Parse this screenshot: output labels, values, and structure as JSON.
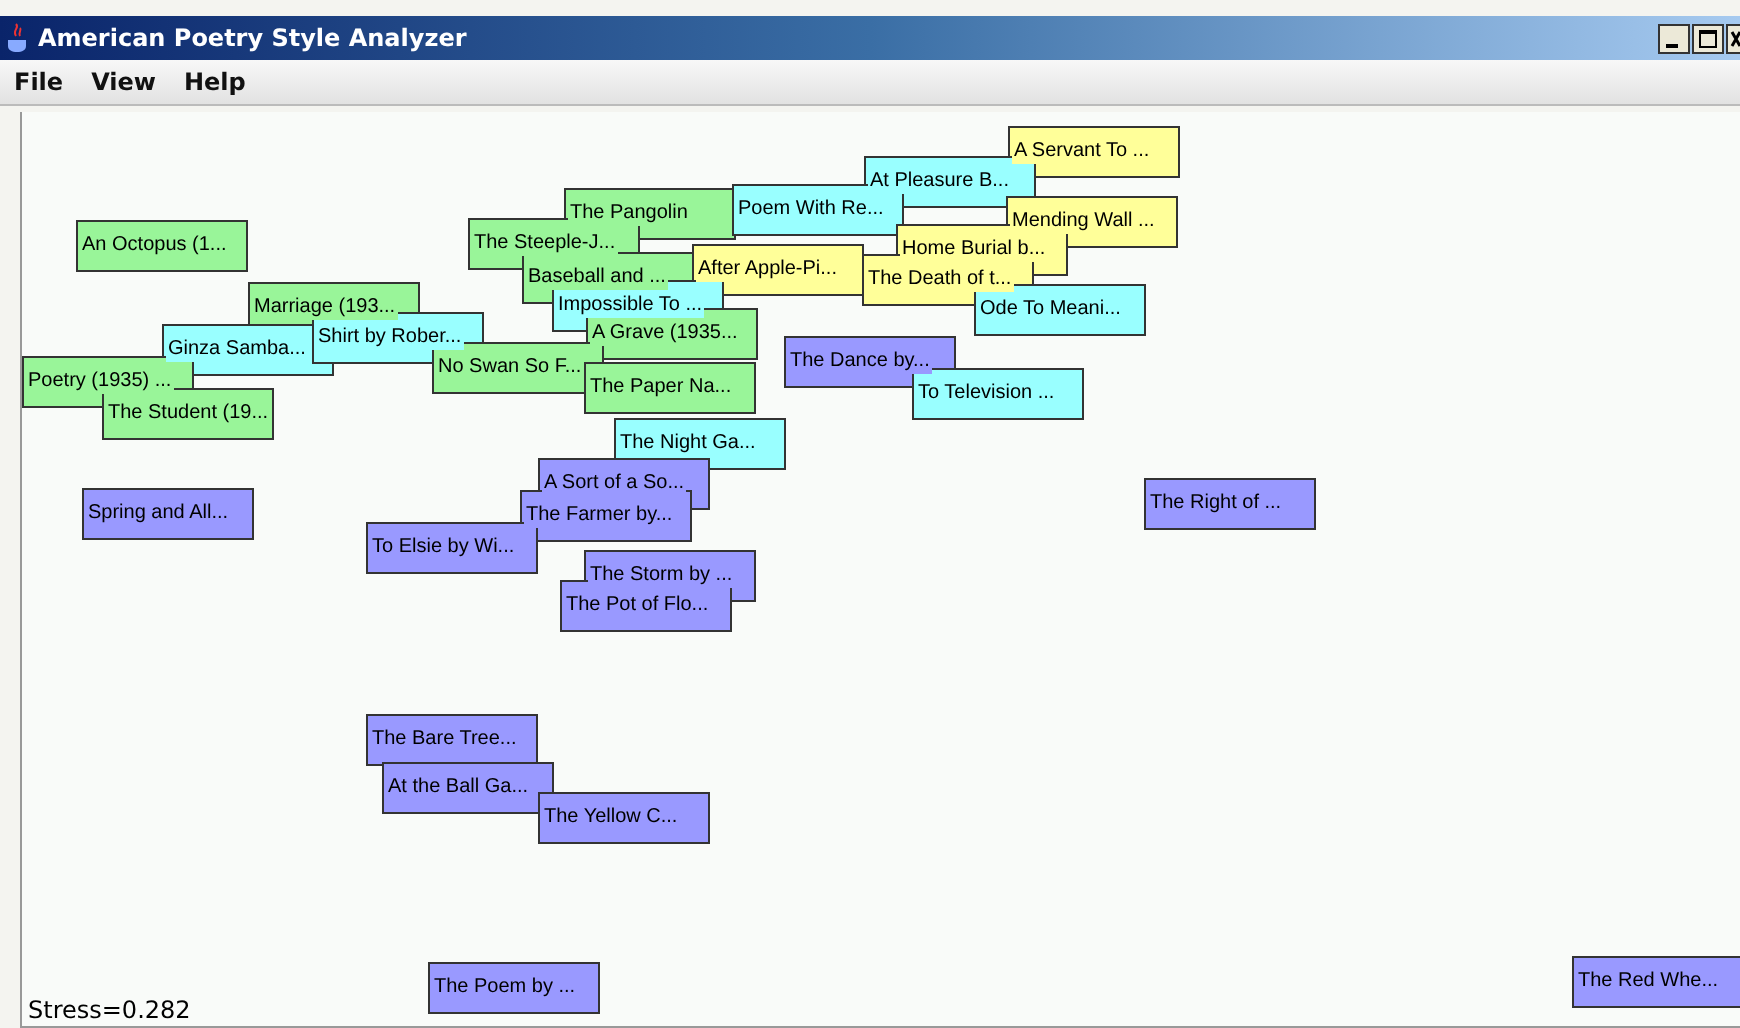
{
  "window": {
    "title": "American Poetry Style Analyzer"
  },
  "menu": [
    "File",
    "View",
    "Help"
  ],
  "nodes": [
    {
      "label": "A Servant To ...",
      "color": "#ffff99"
    },
    {
      "label": "At Pleasure B...",
      "color": "#99ffff"
    },
    {
      "label": "The Pangolin",
      "color": "#99f599"
    },
    {
      "label": "Poem With Re...",
      "color": "#99ffff"
    },
    {
      "label": "Mending Wall ...",
      "color": "#ffff99"
    },
    {
      "label": "An Octopus (1...",
      "color": "#99f599"
    },
    {
      "label": "The Steeple-J...",
      "color": "#99f599"
    },
    {
      "label": "Home Burial b...",
      "color": "#ffff99"
    },
    {
      "label": "Baseball and ...",
      "color": "#99f599"
    },
    {
      "label": "After Apple-Pi...",
      "color": "#ffff99"
    },
    {
      "label": "The Death of t...",
      "color": "#ffff99"
    },
    {
      "label": "Marriage (193...",
      "color": "#99f599"
    },
    {
      "label": "Impossible To ...",
      "color": "#99ffff"
    },
    {
      "label": "Ode To Meani...",
      "color": "#99ffff"
    },
    {
      "label": "Ginza Samba...",
      "color": "#99ffff"
    },
    {
      "label": "Shirt by Rober...",
      "color": "#99ffff"
    },
    {
      "label": "A Grave (1935...",
      "color": "#99f599"
    },
    {
      "label": "Poetry (1935) ...",
      "color": "#99f599"
    },
    {
      "label": "No Swan So F...",
      "color": "#99f599"
    },
    {
      "label": "The Paper Na...",
      "color": "#99f599"
    },
    {
      "label": "The Dance by...",
      "color": "#9999ff"
    },
    {
      "label": "To Television ...",
      "color": "#99ffff"
    },
    {
      "label": "The Student (19...",
      "color": "#99f599"
    },
    {
      "label": "The Night Ga...",
      "color": "#99ffff"
    },
    {
      "label": "A Sort of a So...",
      "color": "#9999ff"
    },
    {
      "label": "The Right of ...",
      "color": "#9999ff"
    },
    {
      "label": "Spring and All...",
      "color": "#9999ff"
    },
    {
      "label": "The Farmer by...",
      "color": "#9999ff"
    },
    {
      "label": "To Elsie by Wi...",
      "color": "#9999ff"
    },
    {
      "label": "The Storm by ...",
      "color": "#9999ff"
    },
    {
      "label": "The Pot of Flo...",
      "color": "#9999ff"
    },
    {
      "label": "The Bare Tree...",
      "color": "#9999ff"
    },
    {
      "label": "At the Ball Ga...",
      "color": "#9999ff"
    },
    {
      "label": "The Yellow C...",
      "color": "#9999ff"
    },
    {
      "label": "The Poem by ...",
      "color": "#9999ff"
    },
    {
      "label": "The Red Whe...",
      "color": "#9999ff"
    }
  ],
  "status": "Stress=0.282"
}
